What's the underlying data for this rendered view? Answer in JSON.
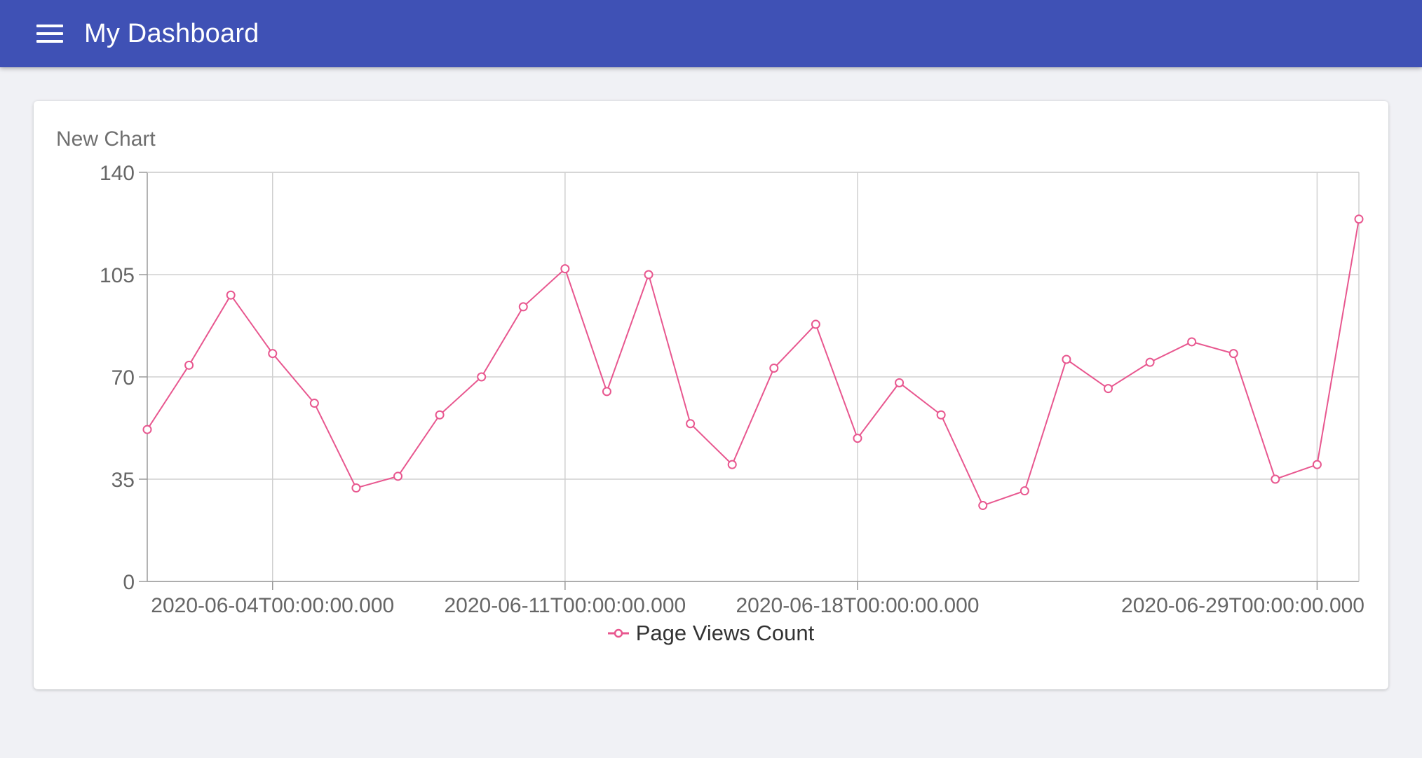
{
  "app": {
    "title": "My Dashboard",
    "menu_icon": "hamburger-menu-icon"
  },
  "card": {
    "title": "New Chart"
  },
  "colors": {
    "appbar": "#3f51b5",
    "series": "#e8578f",
    "grid": "#d0d0d0",
    "background": "#f0f1f5"
  },
  "chart_data": {
    "type": "line",
    "title": "New Chart",
    "x_type": "date",
    "y_ticks": [
      0,
      35,
      70,
      105,
      140
    ],
    "ylim": [
      0,
      140
    ],
    "x_tick_labels": [
      {
        "date": "2020-06-04",
        "label": "2020-06-04T00:00:00.000"
      },
      {
        "date": "2020-06-11",
        "label": "2020-06-11T00:00:00.000"
      },
      {
        "date": "2020-06-18",
        "label": "2020-06-18T00:00:00.000"
      },
      {
        "date": "2020-06-29",
        "label": "2020-06-29T00:00:00.000"
      }
    ],
    "grid": true,
    "legend_position": "bottom",
    "series": [
      {
        "name": "Page Views Count",
        "color": "#e8578f",
        "points": [
          {
            "x": "2020-06-01",
            "y": 52
          },
          {
            "x": "2020-06-02",
            "y": 74
          },
          {
            "x": "2020-06-03",
            "y": 98
          },
          {
            "x": "2020-06-04",
            "y": 78
          },
          {
            "x": "2020-06-05",
            "y": 61
          },
          {
            "x": "2020-06-06",
            "y": 32
          },
          {
            "x": "2020-06-07",
            "y": 36
          },
          {
            "x": "2020-06-08",
            "y": 57
          },
          {
            "x": "2020-06-09",
            "y": 70
          },
          {
            "x": "2020-06-10",
            "y": 94
          },
          {
            "x": "2020-06-11",
            "y": 107
          },
          {
            "x": "2020-06-12",
            "y": 65
          },
          {
            "x": "2020-06-13",
            "y": 105
          },
          {
            "x": "2020-06-14",
            "y": 54
          },
          {
            "x": "2020-06-15",
            "y": 40
          },
          {
            "x": "2020-06-16",
            "y": 73
          },
          {
            "x": "2020-06-17",
            "y": 88
          },
          {
            "x": "2020-06-18",
            "y": 49
          },
          {
            "x": "2020-06-19",
            "y": 68
          },
          {
            "x": "2020-06-20",
            "y": 57
          },
          {
            "x": "2020-06-21",
            "y": 26
          },
          {
            "x": "2020-06-22",
            "y": 31
          },
          {
            "x": "2020-06-23",
            "y": 76
          },
          {
            "x": "2020-06-24",
            "y": 66
          },
          {
            "x": "2020-06-25",
            "y": 75
          },
          {
            "x": "2020-06-26",
            "y": 82
          },
          {
            "x": "2020-06-27",
            "y": 78
          },
          {
            "x": "2020-06-28",
            "y": 35
          },
          {
            "x": "2020-06-29",
            "y": 40
          },
          {
            "x": "2020-06-30",
            "y": 124
          }
        ]
      }
    ]
  }
}
